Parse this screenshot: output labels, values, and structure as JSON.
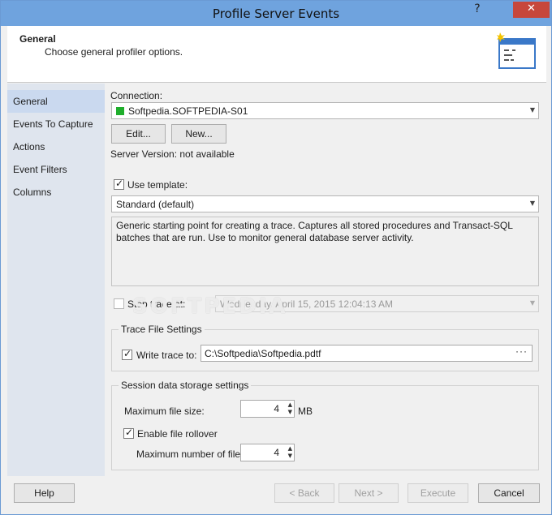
{
  "window": {
    "title": "Profile Server Events",
    "help_symbol": "?",
    "close_symbol": "✕"
  },
  "header": {
    "title": "General",
    "subtitle": "Choose general profiler options."
  },
  "sidebar": {
    "items": [
      {
        "label": "General",
        "active": true
      },
      {
        "label": "Events To Capture",
        "active": false
      },
      {
        "label": "Actions",
        "active": false
      },
      {
        "label": "Event Filters",
        "active": false
      },
      {
        "label": "Columns",
        "active": false
      }
    ]
  },
  "general": {
    "connection_label": "Connection:",
    "connection_value": "Softpedia.SOFTPEDIA-S01",
    "edit_label": "Edit...",
    "new_label": "New...",
    "server_version": "Server Version: not available",
    "use_template_label": "Use template:",
    "use_template_checked": true,
    "template_value": "Standard (default)",
    "template_description": "Generic starting point for creating a trace. Captures all stored procedures and Transact-SQL batches that are run. Use to monitor general database server activity.",
    "stop_trace_label": "Stop trace at:",
    "stop_trace_checked": false,
    "stop_trace_value": "Wednesday, April 15, 2015 12:04:13 AM"
  },
  "trace_file": {
    "group_title": "Trace File Settings",
    "write_trace_label": "Write trace to:",
    "write_trace_checked": true,
    "path": "C:\\Softpedia\\Softpedia.pdtf",
    "browse_label": "···"
  },
  "session": {
    "group_title": "Session data storage settings",
    "max_file_size_label": "Maximum file size:",
    "max_file_size_value": "4",
    "max_file_size_unit": "MB",
    "rollover_label": "Enable file rollover",
    "rollover_checked": true,
    "max_files_label": "Maximum number of files:",
    "max_files_value": "4"
  },
  "footer": {
    "help": "Help",
    "back": "< Back",
    "next": "Next >",
    "execute": "Execute",
    "cancel": "Cancel"
  },
  "watermark": "SOFTPEDIA",
  "colors": {
    "titlebar": "#6fa3de",
    "close_button": "#c7473b",
    "sidebar": "#dfe5ee",
    "sidebar_active": "#cad9ef",
    "connection_indicator": "#1fae2c"
  }
}
